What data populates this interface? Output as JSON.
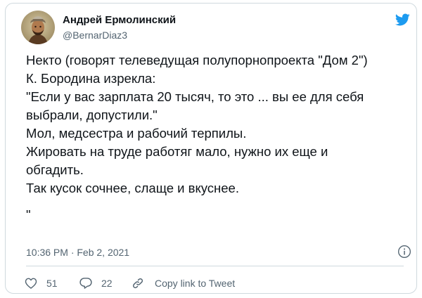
{
  "author": {
    "display_name": "Андрей Ермолинский",
    "handle": "@BernarDiaz3",
    "avatar_icon": "avatar-portrait"
  },
  "logo_icon": "twitter-bird-icon",
  "brand_color": "#1d9bf0",
  "tweet": {
    "lines": [
      "Некто (говорят телеведущая полупорнопроекта \"Дом 2\")",
      "К. Бородина изрекла:",
      "\"Если у вас зарплата 20 тысяч, то это ... вы ее для себя",
      "выбрали, допустили.\"",
      "Мол, медсестра и рабочий терпилы.",
      "Жировать на труде работяг мало, нужно их еще и",
      "обгадить.",
      "Так кусок сочнее, слаще и вкуснее.",
      "\""
    ]
  },
  "timestamp": "10:36 PM · Feb 2, 2021",
  "actions": {
    "likes": "51",
    "replies": "22",
    "copy_link": "Copy link to Tweet"
  }
}
